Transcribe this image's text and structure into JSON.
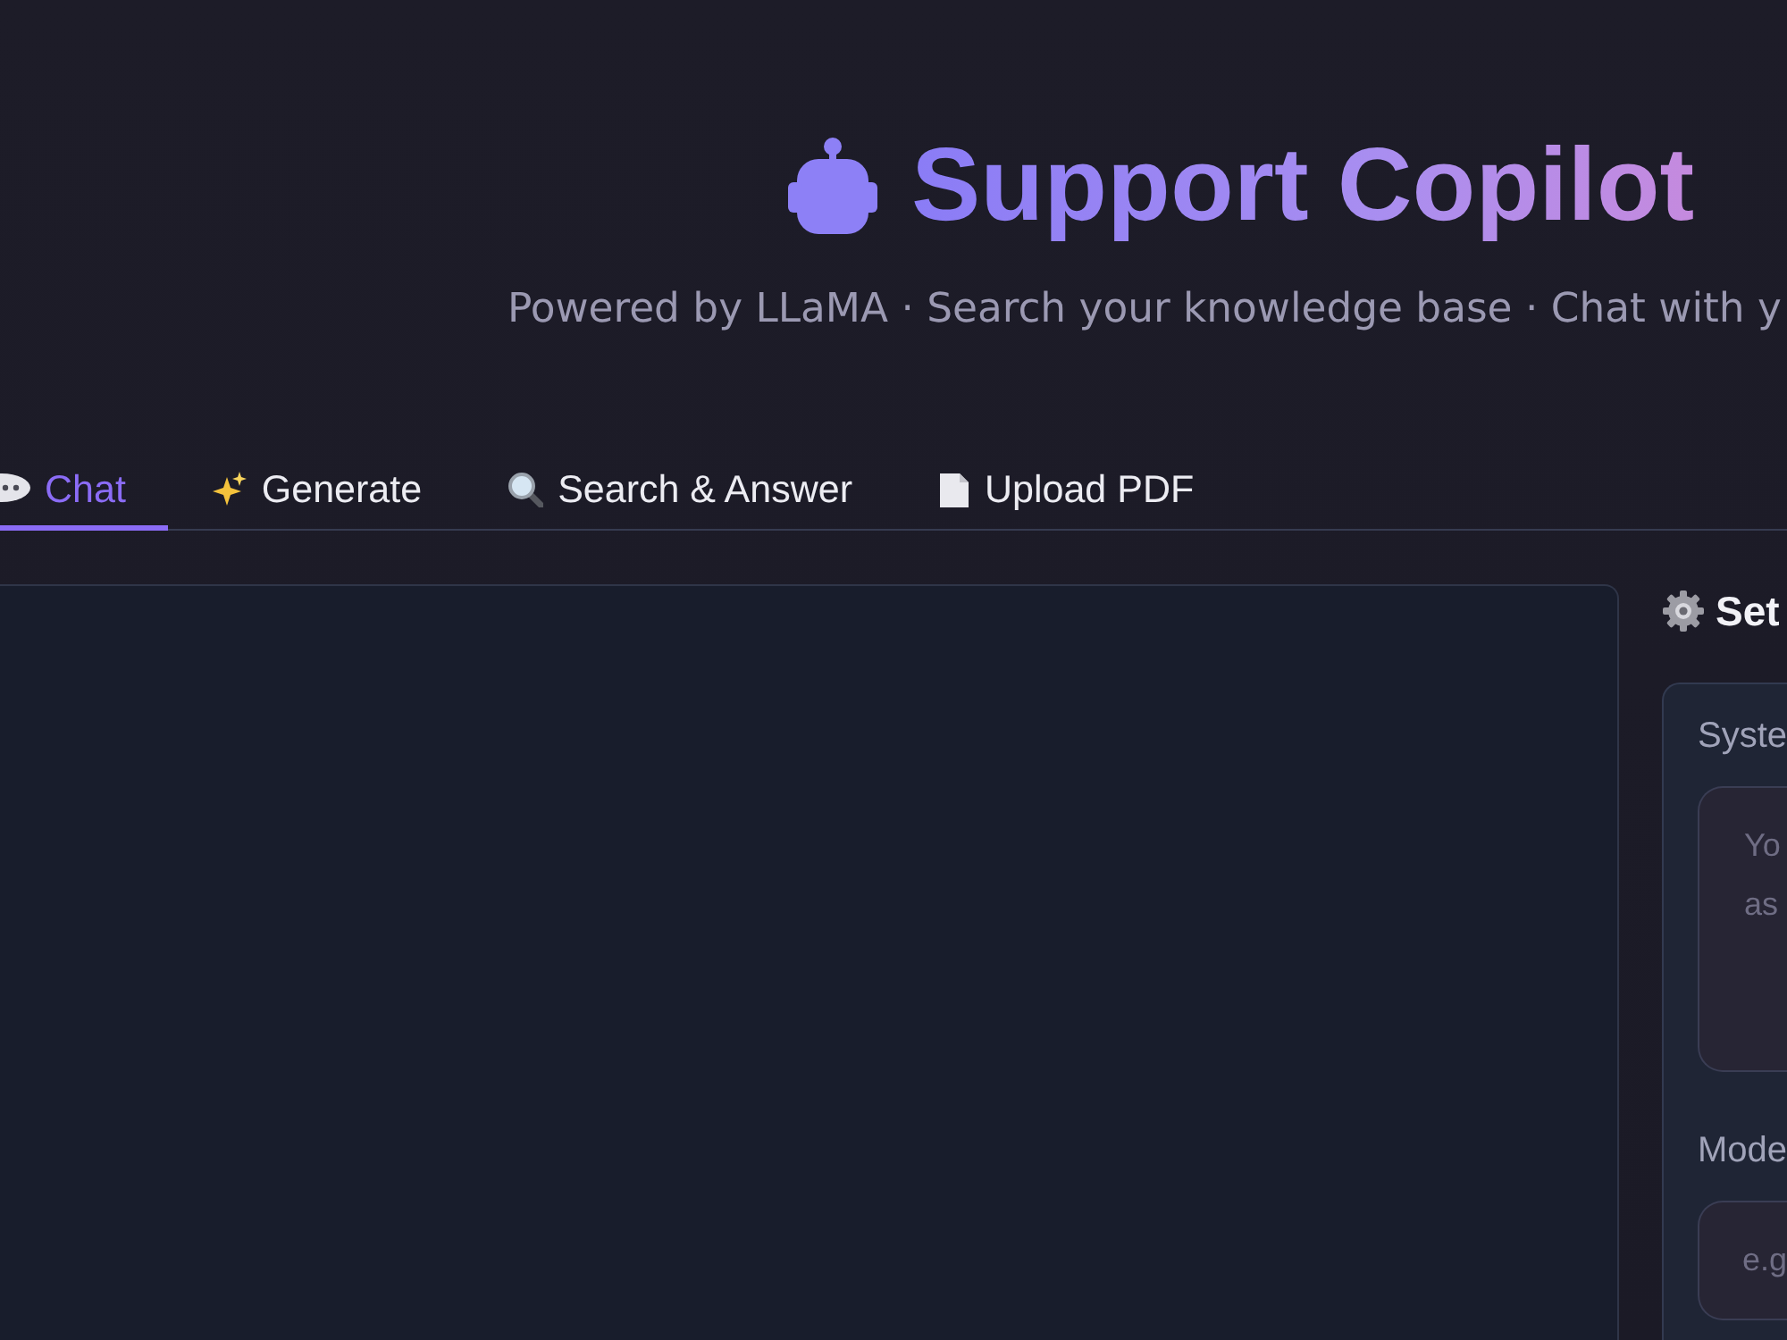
{
  "header": {
    "title": "Support Copilot",
    "subtitle": "Powered by LLaMA · Search your knowledge base · Chat with y"
  },
  "tabs": [
    {
      "label": "Chat",
      "selected": true
    },
    {
      "label": "Generate",
      "selected": false
    },
    {
      "label": "Search & Answer",
      "selected": false
    },
    {
      "label": "Upload PDF",
      "selected": false
    }
  ],
  "settings": {
    "heading": "Set",
    "system_prompt": {
      "label": "Syste",
      "placeholder": "Yo as"
    },
    "model": {
      "label": "Mode",
      "placeholder": "e.g"
    }
  }
}
